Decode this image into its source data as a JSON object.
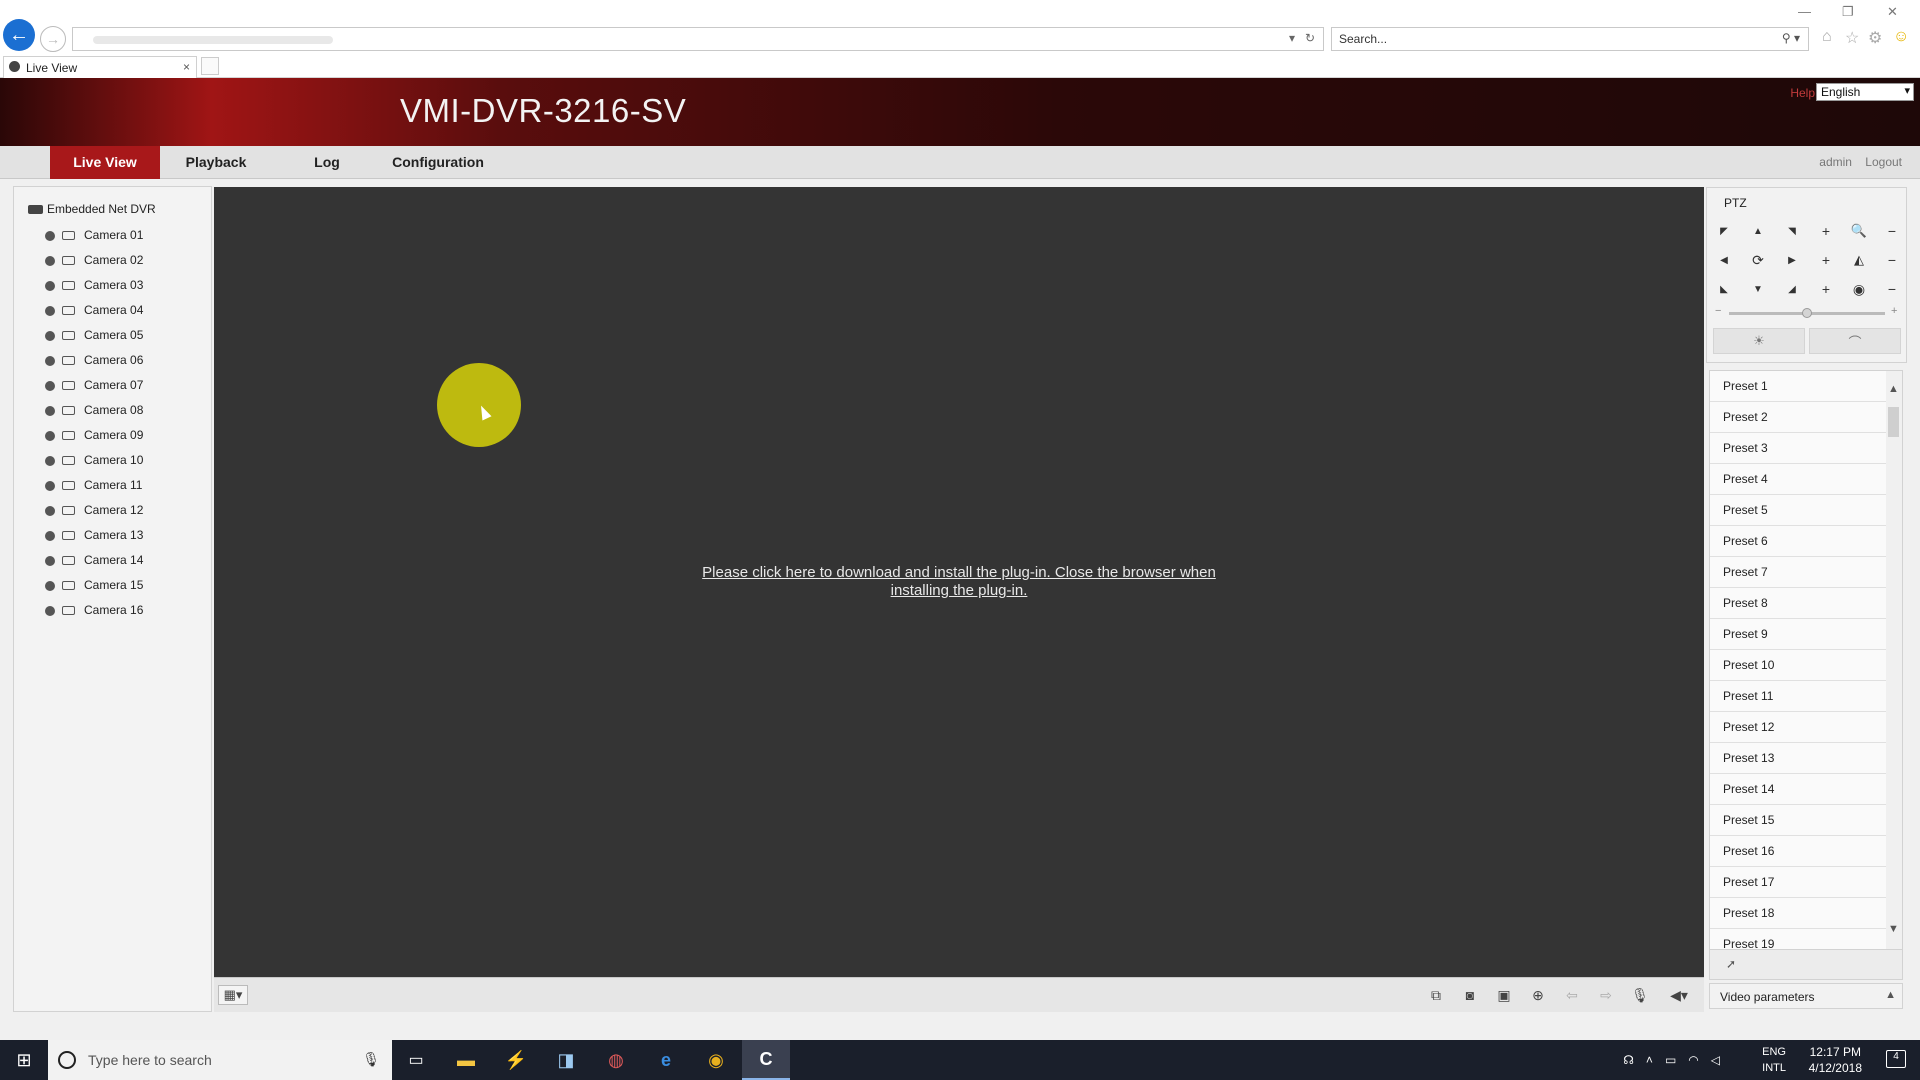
{
  "browser": {
    "search_placeholder": "Search...",
    "tab_title": "Live View",
    "tab_close": "×"
  },
  "header": {
    "device_title": "VMI-DVR-3216-SV",
    "help_label": "Help",
    "language": "English"
  },
  "nav": {
    "tabs": [
      {
        "label": "Live View",
        "active": true
      },
      {
        "label": "Playback",
        "active": false
      },
      {
        "label": "Log",
        "active": false
      },
      {
        "label": "Configuration",
        "active": false
      }
    ],
    "user": "admin",
    "logout": "Logout"
  },
  "device_tree": {
    "root_label": "Embedded Net DVR",
    "cameras": [
      "Camera 01",
      "Camera 02",
      "Camera 03",
      "Camera 04",
      "Camera 05",
      "Camera 06",
      "Camera 07",
      "Camera 08",
      "Camera 09",
      "Camera 10",
      "Camera 11",
      "Camera 12",
      "Camera 13",
      "Camera 14",
      "Camera 15",
      "Camera 16"
    ]
  },
  "video": {
    "plugin_message": "Please click here to download and install the plug-in. Close the browser when installing the plug-in."
  },
  "ptz": {
    "title": "PTZ",
    "speed_level": 0.5,
    "presets": [
      "Preset 1",
      "Preset 2",
      "Preset 3",
      "Preset 4",
      "Preset 5",
      "Preset 6",
      "Preset 7",
      "Preset 8",
      "Preset 9",
      "Preset 10",
      "Preset 11",
      "Preset 12",
      "Preset 13",
      "Preset 14",
      "Preset 15",
      "Preset 16",
      "Preset 17",
      "Preset 18",
      "Preset 19"
    ],
    "video_parameters_label": "Video parameters"
  },
  "taskbar": {
    "search_placeholder": "Type here to search",
    "lang_top": "ENG",
    "lang_bottom": "INTL",
    "time": "12:17 PM",
    "date": "4/12/2018",
    "notification_count": "4"
  },
  "colors": {
    "accent_red": "#a8181a",
    "video_bg": "#343434",
    "cursor_highlight": "#d2cd0a"
  }
}
